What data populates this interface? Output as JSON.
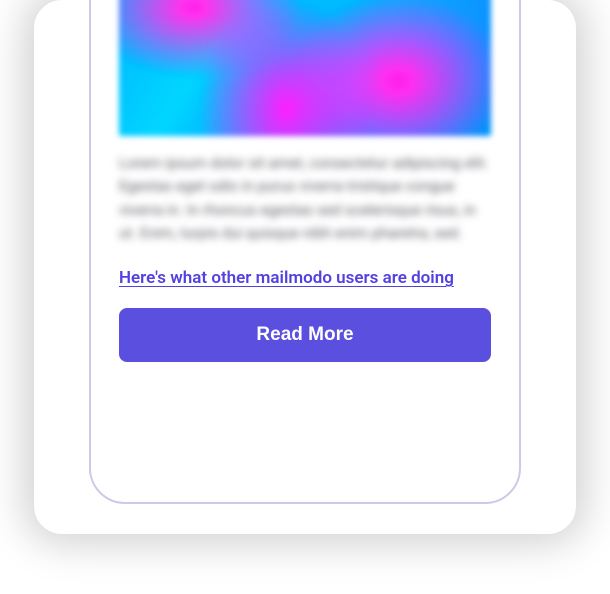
{
  "card": {
    "body_text": "Lorem ipsum dolor sit amet, consectetur adipiscing elit. Egestas eget odio in purus viverra tristique congue viverra in. In rhoncus egestas sed scelerisque risus, in ut. Enim, turpis dui quisque nibh enim pharetra, sed.",
    "link_text": "Here's what other mailmodo users are doing",
    "cta_label": "Read More"
  }
}
